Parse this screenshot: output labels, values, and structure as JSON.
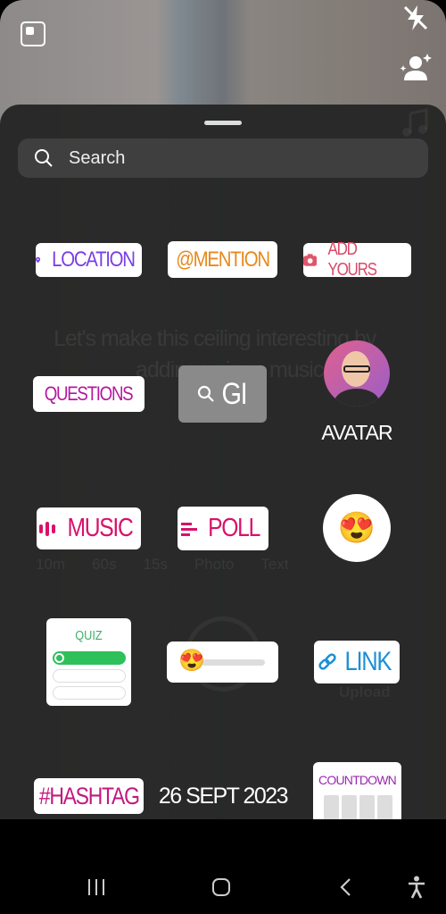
{
  "camera": {
    "background_caption": [
      "Let's make this ceiling interesting by",
      "adding unique music"
    ],
    "modes": [
      "10m",
      "60s",
      "15s",
      "Photo",
      "Text"
    ],
    "upload_label": "Upload"
  },
  "icons": {
    "top_left": "gallery-square-icon",
    "flash": "flash-off-icon",
    "add_person": "add-person-sparkle-icon",
    "music": "music-note-icon"
  },
  "search": {
    "placeholder": "Search"
  },
  "stickers": {
    "location": {
      "label": "LOCATION",
      "color": "#7b3fe4"
    },
    "mention": {
      "label": "@MENTION",
      "color": "#e8891d"
    },
    "add_yours": {
      "label": "ADD YOURS",
      "color": "#d94a6a"
    },
    "questions": {
      "label": "QUESTIONS",
      "color": "#b5179e"
    },
    "gif": {
      "label": "GI"
    },
    "avatar": {
      "label": "AVATAR"
    },
    "music": {
      "label": "MUSIC",
      "color": "#d8116b"
    },
    "poll": {
      "label": "POLL",
      "color": "#d8116b"
    },
    "emoji": {
      "emoji": "😍"
    },
    "quiz": {
      "label": "QUIZ",
      "color": "#3fb06a"
    },
    "slider": {
      "emoji": "😍"
    },
    "link": {
      "label": "LINK",
      "color": "#1d8fd6"
    },
    "hashtag": {
      "label": "#HASHTAG",
      "color": "#c2187e"
    },
    "date": {
      "label": "26 SEPT 2023"
    },
    "countdown": {
      "label": "COUNTDOWN",
      "color": "#9b27b0"
    }
  },
  "navbar": {
    "recents": "recents-icon",
    "home": "home-icon",
    "back": "back-icon",
    "accessibility": "accessibility-icon"
  }
}
